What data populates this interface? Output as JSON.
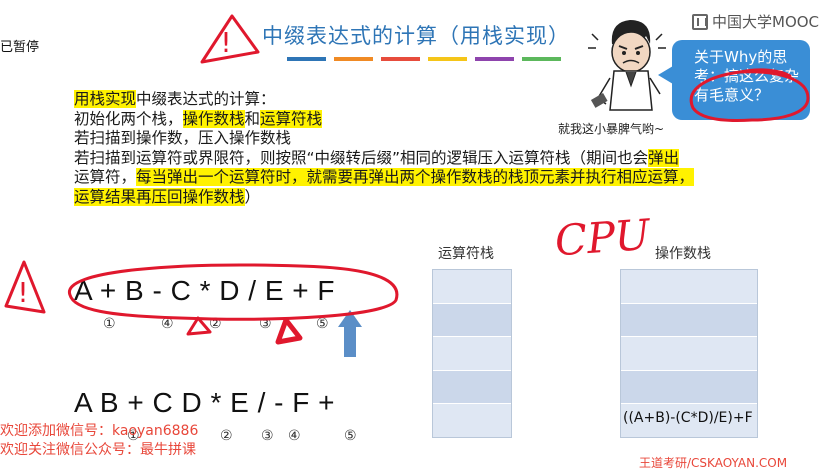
{
  "status": {
    "paused_label": "已暂停"
  },
  "slide": {
    "title": "中缀表达式的计算（用栈实现）",
    "bar_colors": [
      "#2e75b6",
      "#f08a24",
      "#e74c3c",
      "#f5c518",
      "#8e44ad",
      "#5cb85c"
    ],
    "cartoon_caption": "就我这小暴脾气哟~",
    "bubble_text": "关于Why的思考：搞这么复杂有毛意义？",
    "desc_line1_hl": "用栈实现",
    "desc_line1_rest": "中缀表达式的计算：",
    "desc_line2_a": "初始化两个栈，",
    "desc_line2_hl1": "操作数栈",
    "desc_line2_b": "和",
    "desc_line2_hl2": "运算符栈",
    "desc_line3": "若扫描到操作数，压入操作数栈",
    "desc_line4_a": "若扫描到运算符或界限符，则按照“中缀转后缀”相同的逻辑压入运算符栈（期间也会",
    "desc_line4_hl": "弹出",
    "desc_line5_a": "运算符，",
    "desc_line5_hl": "每当弹出一个运算符时，就需要再弹出两个操作数栈的栈顶元素并执行相应运算，",
    "desc_line6_hl": "运算结果再压回操作数栈",
    "desc_line6_b": "）",
    "operator_stack_label": "运算符栈",
    "operand_stack_label": "操作数栈",
    "handwritten_cpu": "CPU",
    "infix_expression": "A + B - C * D / E + F",
    "infix_markers": [
      "①",
      "④",
      "②",
      "③",
      "⑤"
    ],
    "postfix_expression": "A B + C D * E / - F +",
    "postfix_markers": [
      "①",
      "②",
      "③",
      "④",
      "⑤"
    ],
    "operand_stack_top": "((A+B)-(C*D)/E)+F",
    "watermark_line1": "欢迎添加微信号：kaoyan6886",
    "watermark_line2": "欢迎关注微信公众号：最牛拼课",
    "site_url": "王道考研/CSKAOYAN.COM"
  },
  "brand": {
    "name": "中国大学MOOC"
  },
  "annotations": {
    "pen_color": "#e0182d",
    "exclamation": "!"
  }
}
